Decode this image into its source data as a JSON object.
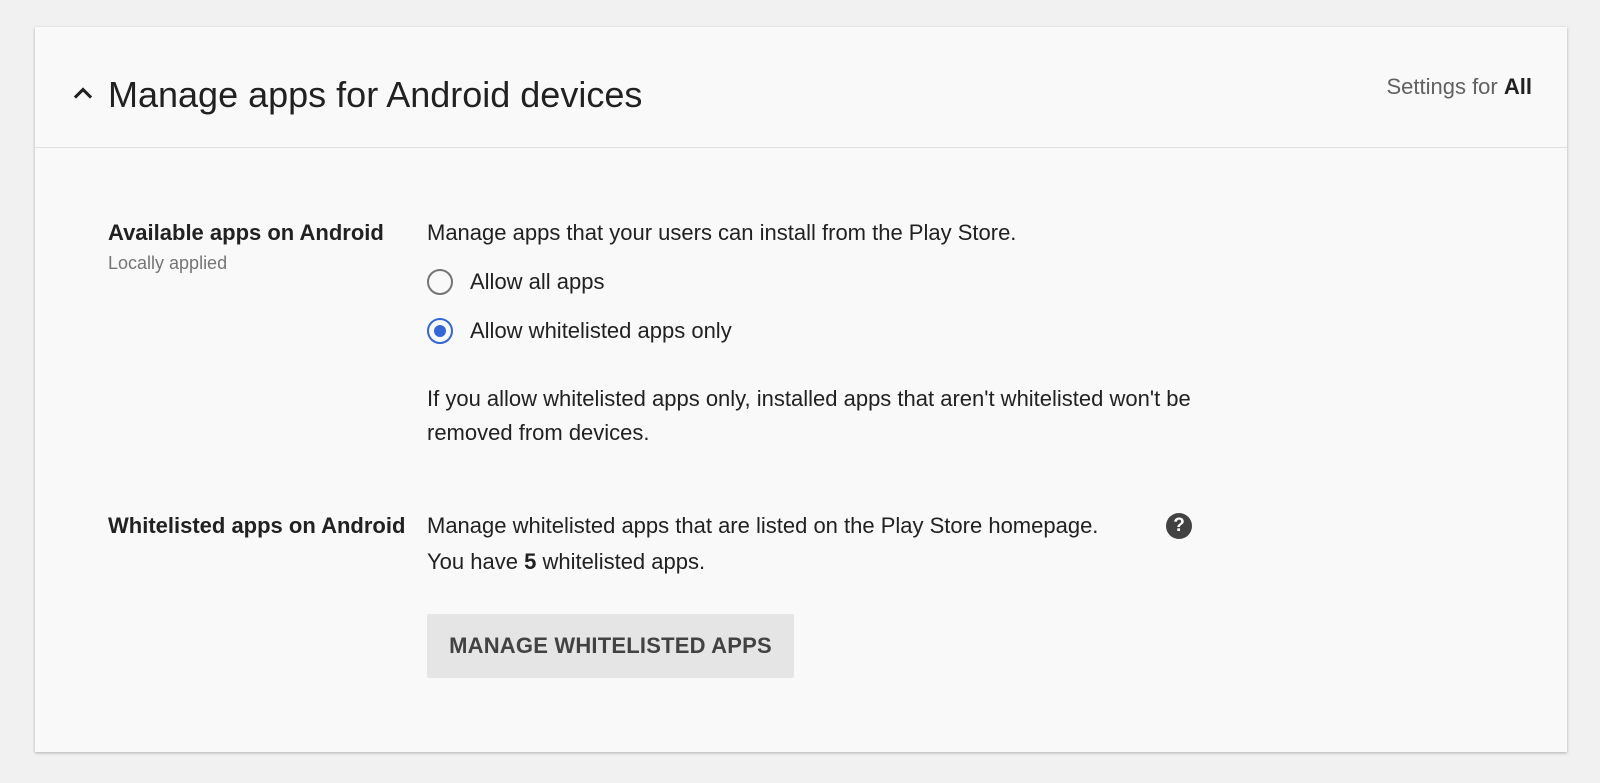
{
  "header": {
    "title": "Manage apps for Android devices",
    "settings_prefix": "Settings for",
    "settings_scope": "All"
  },
  "available_apps": {
    "label": "Available apps on Android",
    "sublabel": "Locally applied",
    "description": "Manage apps that your users can install from the Play Store.",
    "options": [
      {
        "label": "Allow all apps",
        "checked": false
      },
      {
        "label": "Allow whitelisted apps only",
        "checked": true
      }
    ],
    "note_line1": "If you allow whitelisted apps only, installed apps that aren't whitelisted won't be",
    "note_line2": "removed from devices."
  },
  "whitelisted_apps": {
    "label": "Whitelisted apps on Android",
    "description": "Manage whitelisted apps that are listed on the Play Store homepage.",
    "count_prefix": "You have",
    "count": "5",
    "count_suffix": "whitelisted apps.",
    "button_label": "MANAGE WHITELISTED APPS"
  },
  "icons": {
    "collapse": "chevron-up-icon",
    "help": "help-circle-icon"
  },
  "colors": {
    "accent": "#3367d6",
    "background": "#f1f1f1",
    "card": "#f9f9f9",
    "button": "#e5e5e5"
  }
}
